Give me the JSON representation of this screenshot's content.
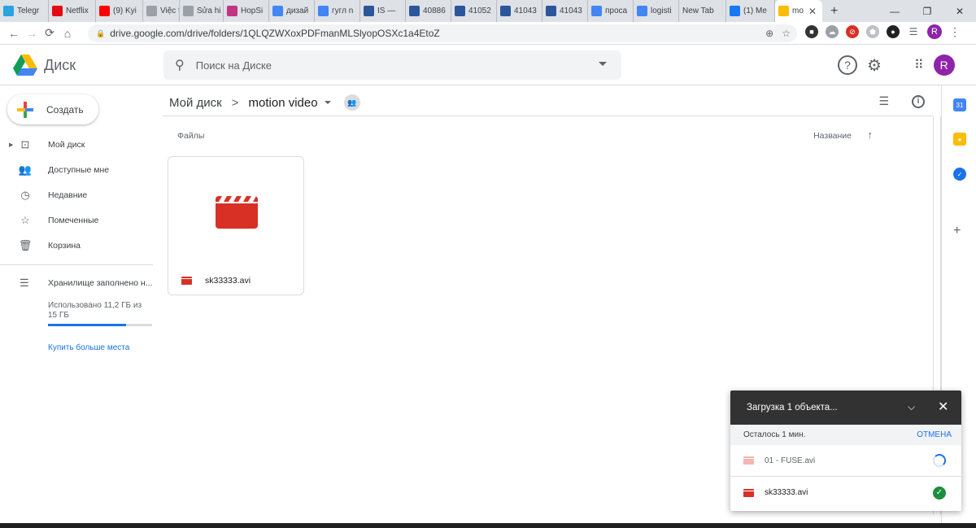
{
  "browser": {
    "tabs": [
      {
        "label": "Telegr",
        "icon": "telegram-icon",
        "color": "#2aa3e0"
      },
      {
        "label": "Netflix",
        "icon": "netflix-icon",
        "color": "#e50914"
      },
      {
        "label": "(9) Kyi",
        "icon": "youtube-icon",
        "color": "#ff0000"
      },
      {
        "label": "Việc fr",
        "icon": "vietnamworks-icon",
        "color": "#9aa0a6"
      },
      {
        "label": "Sửa hi",
        "icon": "vietnamworks-icon",
        "color": "#9aa0a6"
      },
      {
        "label": "HopSi",
        "icon": "instagram-icon",
        "color": "#c13584"
      },
      {
        "label": "дизай",
        "icon": "google-icon",
        "color": "#4285f4"
      },
      {
        "label": "гугл n",
        "icon": "google-icon",
        "color": "#4285f4"
      },
      {
        "label": "IS —",
        "icon": "word-icon",
        "color": "#2b579a"
      },
      {
        "label": "40886",
        "icon": "word-icon",
        "color": "#2b579a"
      },
      {
        "label": "41052",
        "icon": "word-icon",
        "color": "#2b579a"
      },
      {
        "label": "41043",
        "icon": "word-icon",
        "color": "#2b579a"
      },
      {
        "label": "41043",
        "icon": "word-icon",
        "color": "#2b579a"
      },
      {
        "label": "проса",
        "icon": "google-icon",
        "color": "#4285f4"
      },
      {
        "label": "logisti",
        "icon": "google-icon",
        "color": "#4285f4"
      },
      {
        "label": "New Tab",
        "icon": "none",
        "color": ""
      },
      {
        "label": "(1) Me",
        "icon": "facebook-icon",
        "color": "#1877f2"
      },
      {
        "label": "mo",
        "icon": "drive-icon",
        "color": "#fbbc04",
        "active": true
      }
    ],
    "url": "drive.google.com/drive/folders/1QLQZWXoxPDFmanMLSlyopOSXc1a4EtoZ",
    "profile_initial": "R"
  },
  "header": {
    "app_name": "Диск",
    "search_placeholder": "Поиск на Диске",
    "avatar_initial": "R",
    "accent": "#8e24aa"
  },
  "sidebar": {
    "create_label": "Создать",
    "items": [
      {
        "label": "Мой диск",
        "icon": "my-drive-icon"
      },
      {
        "label": "Доступные мне",
        "icon": "shared-with-me-icon"
      },
      {
        "label": "Недавние",
        "icon": "recent-clock-icon"
      },
      {
        "label": "Помеченные",
        "icon": "star-icon"
      },
      {
        "label": "Корзина",
        "icon": "trash-icon"
      }
    ],
    "storage_label": "Хранилище заполнено н...",
    "storage_usage": "Использовано 11,2 ГБ из 15 ГБ",
    "storage_fraction": 0.747,
    "buy_more": "Купить больше места"
  },
  "main": {
    "breadcrumb_root": "Мой диск",
    "breadcrumb_sep": ">",
    "breadcrumb_current": "motion video",
    "files_label": "Файлы",
    "sort_label": "Название",
    "file": {
      "name": "sk33333.avi",
      "type_icon": "video-file-icon",
      "color": "#d93025"
    }
  },
  "upload": {
    "title": "Загрузка 1 объекта...",
    "remaining": "Осталось 1 мин.",
    "cancel": "ОТМЕНА",
    "items": [
      {
        "name": "01 - FUSE.avi",
        "status": "uploading"
      },
      {
        "name": "sk33333.avi",
        "status": "done"
      }
    ]
  }
}
